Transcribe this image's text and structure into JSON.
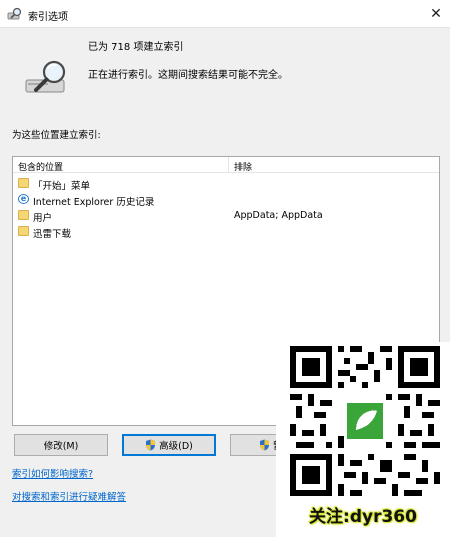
{
  "window": {
    "title": "索引选项",
    "close_glyph": "✕"
  },
  "status": {
    "count_text": "已为 718 项建立索引",
    "progress_text": "正在进行索引。这期间搜索结果可能不完全。"
  },
  "locations": {
    "section_label": "为这些位置建立索引:",
    "header_included": "包含的位置",
    "header_excluded": "排除",
    "rows": [
      {
        "location": "「开始」菜单",
        "excluded": "",
        "icon": "folder-icon"
      },
      {
        "location": "Internet Explorer 历史记录",
        "excluded": "",
        "icon": "ie-icon"
      },
      {
        "location": "用户",
        "excluded": "AppData; AppData",
        "icon": "folder-icon"
      },
      {
        "location": "迅雷下载",
        "excluded": "",
        "icon": "folder-icon"
      }
    ]
  },
  "buttons": {
    "modify": "修改(M)",
    "advanced": "高级(D)",
    "pause": "暂"
  },
  "links": {
    "help_search": "索引如何影响搜索?",
    "troubleshoot": "对搜索和索引进行疑难解答"
  },
  "overlay": {
    "qr_caption": "关注:dyr360"
  },
  "colors": {
    "link": "#0066cc",
    "folder": "#f5d675",
    "focus_border": "#0078d7",
    "caption_glow": "#d7e62c"
  }
}
